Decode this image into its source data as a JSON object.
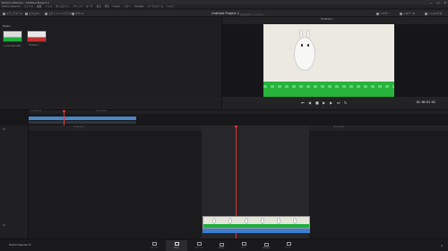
{
  "window": {
    "title": "DaVinci Resolve - Untitled Project 1",
    "controls": [
      "—",
      "□",
      "✕"
    ]
  },
  "menu": [
    "DaVinci Resolve",
    "ファイル",
    "編集",
    "トリム",
    "タイムライン",
    "クリップ",
    "マーク",
    "表示",
    "再生",
    "Fusion",
    "カラー",
    "Fairlight",
    "ワークスペース",
    "ヘルプ"
  ],
  "toolbar": {
    "media_pool_label": "メディアプール",
    "effects_label": "エフェクト",
    "edit_index_label": "エディットインデックス",
    "sound_library_label": "サウンド",
    "project_title": "Untitled Project 1",
    "project_subtitle": "変更を保存していません",
    "mixer_label": "ミキサー",
    "metadata_label": "メタデータ",
    "inspector_label": "インスペクタ"
  },
  "media_pool": {
    "header": "Master",
    "clips": [
      {
        "label": "ハナ01-1920-1080"
      },
      {
        "label": "Timeline 1"
      }
    ]
  },
  "viewer": {
    "title": "Timeline 1",
    "timecode": "01:00:01:02"
  },
  "timeline": {
    "upper_ruler_labels": [
      "01:00:00:00",
      "01:00:05:00"
    ],
    "ruler_labels": [
      "01:00:00:00",
      "01:00:05:00",
      "01:00:10:00"
    ],
    "track_labels": [
      "V1",
      "A1"
    ]
  },
  "pages": {
    "app_name": "DaVinci Resolve 17",
    "tabs": [
      {
        "label": "メディア",
        "active": false
      },
      {
        "label": "カット",
        "active": true
      },
      {
        "label": "エディット",
        "active": false
      },
      {
        "label": "Fusion",
        "active": false
      },
      {
        "label": "カラー",
        "active": false
      },
      {
        "label": "Fairlight",
        "active": false
      },
      {
        "label": "デリバー",
        "active": false
      }
    ]
  }
}
